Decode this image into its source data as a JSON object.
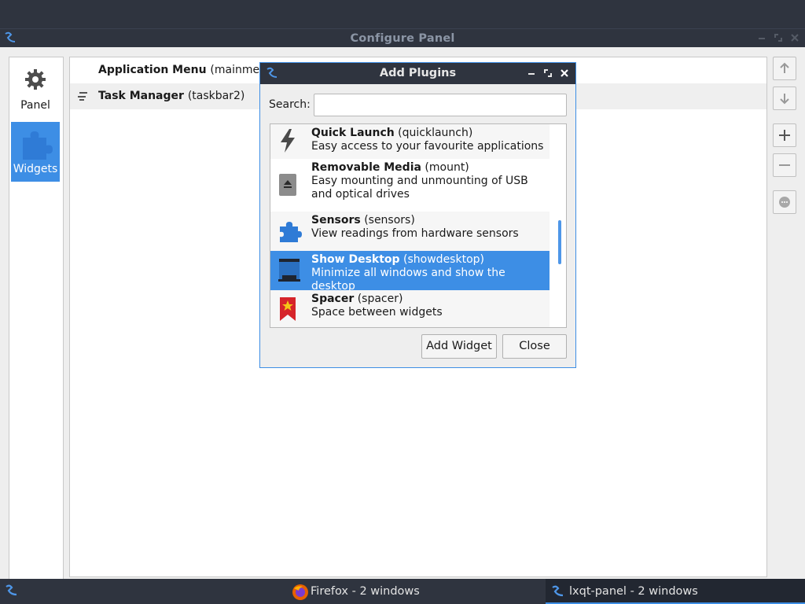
{
  "main_window": {
    "title": "Configure Panel",
    "sidebar": [
      {
        "label": "Panel",
        "icon": "gear-icon"
      },
      {
        "label": "Widgets",
        "icon": "puzzle-icon",
        "selected": true
      }
    ],
    "widgets": [
      {
        "name": "Application Menu",
        "id": "(mainmenu)"
      },
      {
        "name": "Task Manager",
        "id": "(taskbar2)"
      }
    ],
    "right_buttons": [
      "move-up",
      "move-down",
      "add",
      "remove",
      "configure"
    ]
  },
  "dialog": {
    "title": "Add Plugins",
    "search_label": "Search:",
    "search_value": "",
    "plugins": [
      {
        "name": "Quick Launch",
        "id": "(quicklaunch)",
        "desc": "Easy access to your favourite applications",
        "icon": "lightning-icon"
      },
      {
        "name": "Removable Media",
        "id": "(mount)",
        "desc": "Easy mounting and unmounting of USB and optical drives",
        "icon": "eject-icon"
      },
      {
        "name": "Sensors",
        "id": "(sensors)",
        "desc": "View readings from hardware sensors",
        "icon": "puzzle-icon"
      },
      {
        "name": "Show Desktop",
        "id": "(showdesktop)",
        "desc": "Minimize all windows and show the desktop",
        "icon": "desktop-icon",
        "selected": true
      },
      {
        "name": "Spacer",
        "id": "(spacer)",
        "desc": "Space between widgets",
        "icon": "bookmark-star-icon"
      }
    ],
    "add_button": "Add Widget",
    "close_button": "Close"
  },
  "taskbar": {
    "tasks": [
      {
        "label": "Firefox - 2 windows",
        "icon": "firefox-icon"
      },
      {
        "label": "lxqt-panel - 2 windows",
        "icon": "lxqt-icon",
        "active": true
      }
    ]
  },
  "colors": {
    "accent": "#3d8ee5",
    "titlebar": "#2f343f",
    "window_bg": "#eeeeee"
  }
}
